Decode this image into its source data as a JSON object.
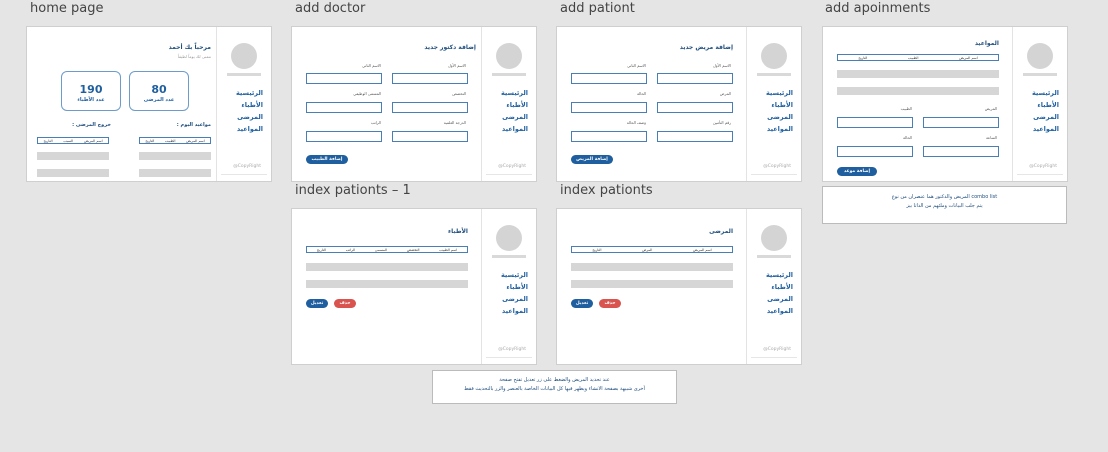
{
  "frames": {
    "home": {
      "title": "home page"
    },
    "add_doctor": {
      "title": "add doctor"
    },
    "add_patient": {
      "title": "add pationt"
    },
    "add_appointments": {
      "title": "add apoinments"
    },
    "index_patients_1": {
      "title": "index pationts – 1"
    },
    "index_patients": {
      "title": "index pationts"
    }
  },
  "sidebar": {
    "items": [
      "الرئيسية",
      "الأطباء",
      "المرضى",
      "المواعيد"
    ],
    "copyright": "@CopyRight"
  },
  "home": {
    "welcome": "مرحباً بك أحمد",
    "subtitle": "نتمنى لك يوماً لطيفاً",
    "stats": [
      {
        "value": "80",
        "label": "عدد المرضى"
      },
      {
        "value": "190",
        "label": "عدد الأطباء"
      }
    ],
    "today_appointments": "مواعيد اليوم :",
    "patient_exits": "خروج المرضى :",
    "appt_columns": [
      "اسم المريض",
      "الطبيب",
      "التاريخ"
    ],
    "exit_columns": [
      "اسم المريض",
      "السبب",
      "التاريخ"
    ]
  },
  "add_doctor": {
    "title": "إضافة دكتور جديد",
    "labels": [
      "الاسم الأول",
      "الاسم الثاني",
      "التخصص",
      "المسمى الوظيفي",
      "الدرجة العلمية",
      "الراتب"
    ],
    "button": "إضافة الطبيب"
  },
  "add_patient": {
    "title": "إضافة مريض جديد",
    "labels": [
      "الاسم الأول",
      "الاسم الثاني",
      "المرض",
      "الحالة",
      "رقم التأمين",
      "وصف الحالة"
    ],
    "button": "إضافة المريض"
  },
  "add_appointments": {
    "title": "المواعيد",
    "columns": [
      "اسم المريض",
      "الطبيب",
      "التاريخ"
    ],
    "labels": [
      "المريض",
      "الطبيب",
      "الساعة",
      "الحالة"
    ],
    "button": "إضافة موعد",
    "note_line1": "المريض والدكتور هما عنصران من نوع  combo list",
    "note_line2": "يتم جلب البيانات وملئهم من الداتا بيز"
  },
  "index_patients_1": {
    "title": "الأطباء",
    "columns": [
      "اسم الطبيب",
      "التخصص",
      "المسمى",
      "الراتب",
      "التاريخ"
    ],
    "delete": "حذف",
    "edit": "تعديل"
  },
  "index_patients": {
    "title": "المرضى",
    "columns": [
      "اسم المريض",
      "المرض",
      "التاريخ"
    ],
    "delete": "حذف",
    "edit": "تعديل",
    "note_line1": "عند تحديد المريض والضغط على زر تعديل تفتح صفحة",
    "note_line2": "أخرى شبيهة بصفحة الانشاء ويظهر فيها كل البيانات الخاصة بالعنصر والزر بالتحديث فقط"
  }
}
